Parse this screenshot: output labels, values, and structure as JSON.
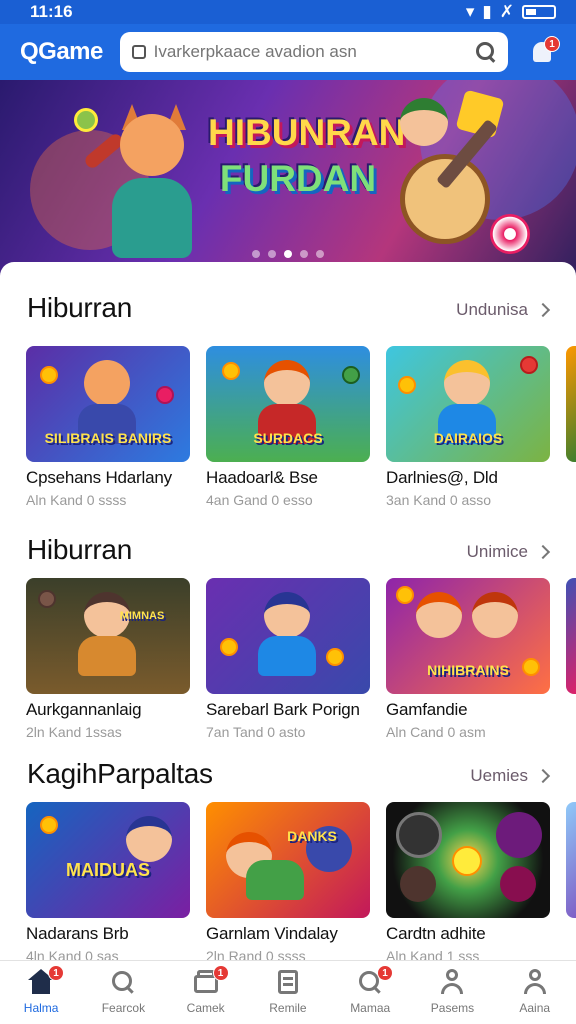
{
  "status_bar": {
    "time": "11:16"
  },
  "header": {
    "logo": "QGame",
    "search_placeholder": "Ivarkerpkaace avadion asn",
    "notification_badge": "1"
  },
  "banner": {
    "title_line1": "HIBUNRAN",
    "title_line2": "FURDAN",
    "active_slide": 2,
    "slide_count": 5
  },
  "sections": [
    {
      "title": "Hiburran",
      "more_label": "Undunisa",
      "cards": [
        {
          "image_text": "SILIBRAIS BANIRS",
          "title": "Cpsehans Hdarlany",
          "subtitle": "Aln Kand 0 ssss"
        },
        {
          "image_text": "SURDACS",
          "title": "Haadoarl& Bse",
          "subtitle": "4an Gand 0 esso"
        },
        {
          "image_text": "DAIRAIOS",
          "title": "Darlnies@, Dld",
          "subtitle": "3an Kand 0 asso"
        }
      ]
    },
    {
      "title": "Hiburran",
      "more_label": "Unimice",
      "cards": [
        {
          "image_text": "MIMNAS",
          "title": "Aurkgannanlaig",
          "subtitle": "2ln Kand 1ssas"
        },
        {
          "image_text": "",
          "title": "Sarebarl Bark Porign",
          "subtitle": "7an Tand 0 asto"
        },
        {
          "image_text": "NIHIBRAINS",
          "title": "Gamfandie",
          "subtitle": "Aln Cand 0 asm"
        }
      ]
    },
    {
      "title": "KagihParpaltas",
      "more_label": "Uemies",
      "cards": [
        {
          "image_text": "MAIDUAS",
          "title": "Nadarans Brb",
          "subtitle": "4ln Kand 0 sas"
        },
        {
          "image_text": "DANKS",
          "title": "Garnlam Vindalay",
          "subtitle": "2ln Rand 0 ssss"
        },
        {
          "image_text": "",
          "title": "Cardtn adhite",
          "subtitle": "Aln Kand 1 sss"
        }
      ]
    }
  ],
  "bottom_nav": [
    {
      "label": "Halma",
      "icon": "home-icon",
      "active": true,
      "badge": "1"
    },
    {
      "label": "Fearcok",
      "icon": "search-icon",
      "active": false,
      "badge": ""
    },
    {
      "label": "Camek",
      "icon": "gift-box-icon",
      "active": false,
      "badge": "1"
    },
    {
      "label": "Remile",
      "icon": "document-icon",
      "active": false,
      "badge": ""
    },
    {
      "label": "Mamaa",
      "icon": "search-user-icon",
      "active": false,
      "badge": "1"
    },
    {
      "label": "Pasems",
      "icon": "badge-icon",
      "active": false,
      "badge": ""
    },
    {
      "label": "Aaina",
      "icon": "profile-icon",
      "active": false,
      "badge": ""
    }
  ],
  "colors": {
    "primary": "#1f6ae0",
    "badge": "#e53935",
    "banner_title": "#ffd84a"
  }
}
